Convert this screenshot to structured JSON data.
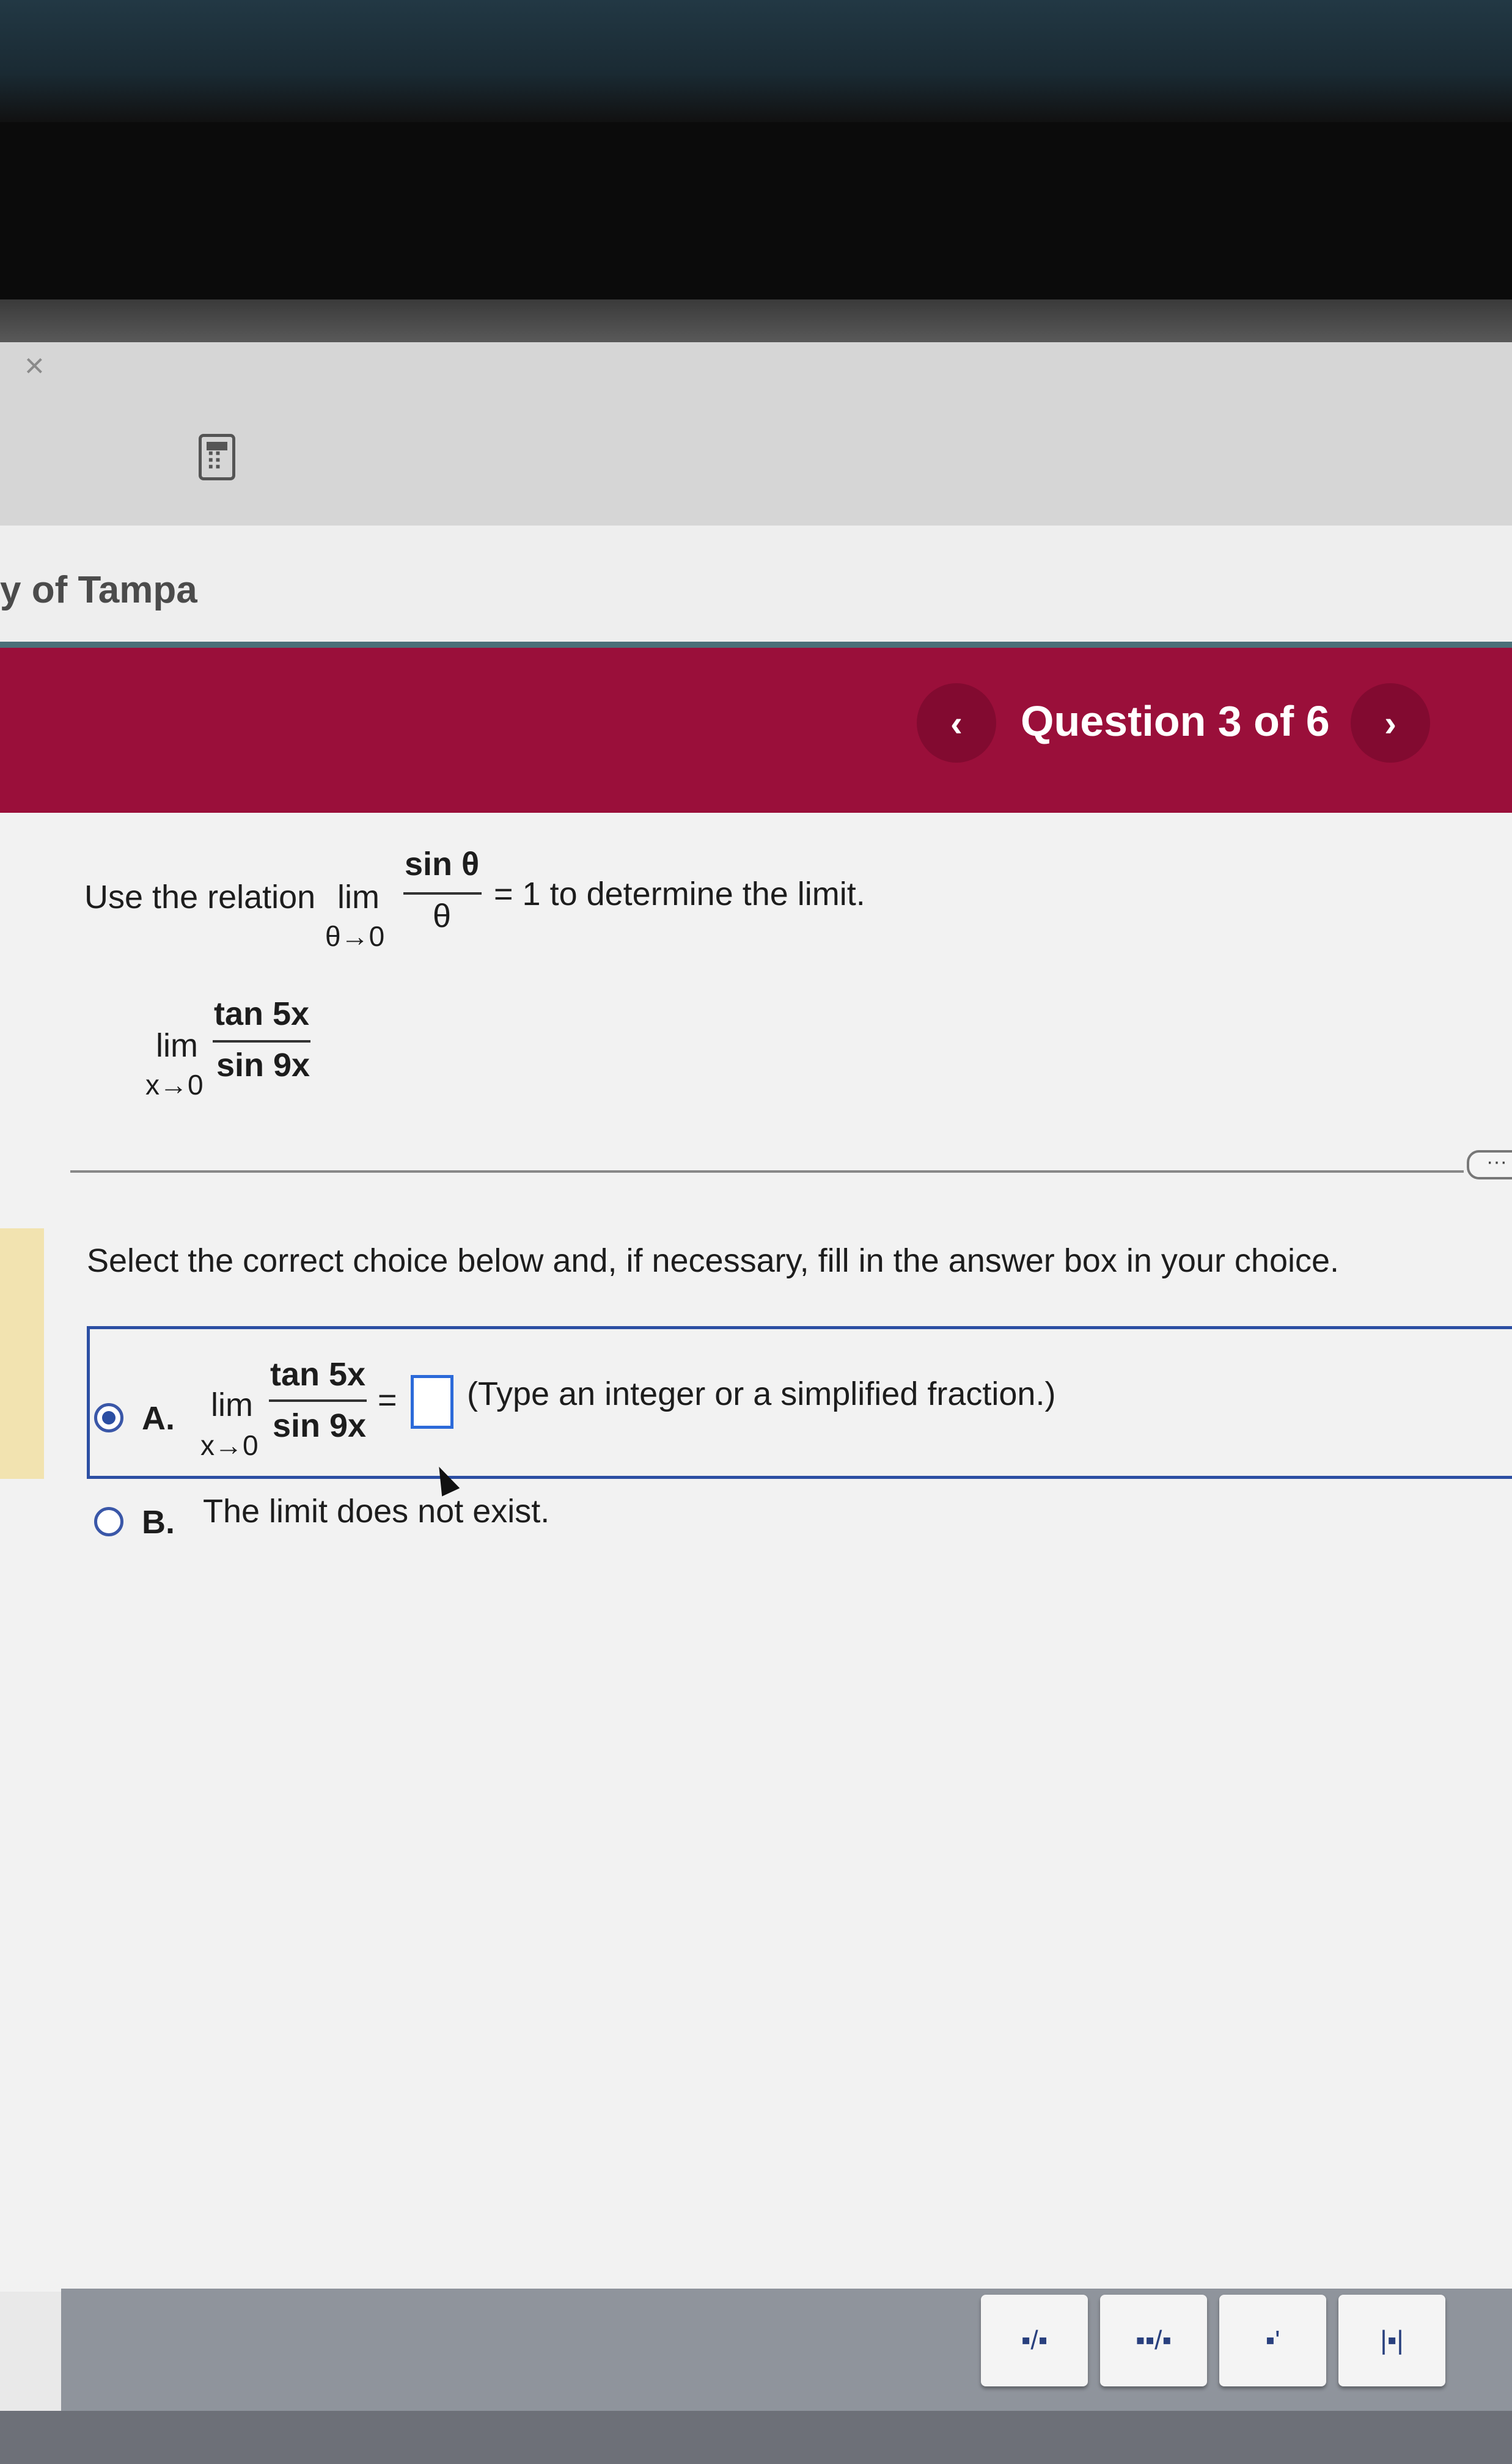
{
  "browser": {
    "close_glyph": "×"
  },
  "header": {
    "school_name": "y of Tampa"
  },
  "nav": {
    "prev_glyph": "‹",
    "next_glyph": "›",
    "question_counter": "Question 3 of 6"
  },
  "question": {
    "prompt_prefix": "Use the relation",
    "prompt_lim": "lim",
    "prompt_sub": "θ→0",
    "prompt_num": "sin θ",
    "prompt_den": "θ",
    "prompt_suffix": "= 1 to determine the limit.",
    "expr_lim": "lim",
    "expr_sub": "x→0",
    "expr_num": "tan 5x",
    "expr_den": "sin 9x"
  },
  "instructions": "Select the correct choice below and, if necessary, fill in the answer box in your choice.",
  "choices": {
    "a": {
      "letter": "A.",
      "lim": "lim",
      "sub": "x→0",
      "num": "tan 5x",
      "den": "sin 9x",
      "equals": "=",
      "hint": "(Type an integer or a simplified fraction.)",
      "selected": true
    },
    "b": {
      "letter": "B.",
      "text": "The limit does not exist.",
      "selected": false
    }
  },
  "more_label": "···",
  "toolbar": {
    "buttons": [
      {
        "icon": "fraction-icon",
        "glyph": "▪/▪"
      },
      {
        "icon": "mixed-number-icon",
        "glyph": "▪▪/▪"
      },
      {
        "icon": "exponent-icon",
        "glyph": "▪'"
      },
      {
        "icon": "absolute-value-icon",
        "glyph": "|▪|"
      }
    ]
  }
}
